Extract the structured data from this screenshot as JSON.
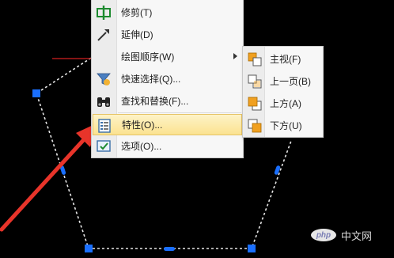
{
  "context_menu": {
    "items": [
      {
        "label": "修剪(T)",
        "icon": "trim-icon"
      },
      {
        "label": "延伸(D)",
        "icon": "extend-icon"
      },
      {
        "label": "绘图顺序(W)",
        "icon": "none",
        "has_submenu": true
      },
      {
        "label": "快速选择(Q)...",
        "icon": "quick-select-icon"
      },
      {
        "label": "查找和替换(F)...",
        "icon": "find-replace-icon"
      },
      {
        "label": "特性(O)...",
        "icon": "properties-icon",
        "highlighted": true
      },
      {
        "label": "选项(O)...",
        "icon": "options-icon"
      }
    ]
  },
  "submenu": {
    "items": [
      {
        "label": "主视(F)",
        "icon": "bring-to-front-icon"
      },
      {
        "label": "上一页(B)",
        "icon": "send-to-back-icon"
      },
      {
        "label": "上方(A)",
        "icon": "bring-above-icon"
      },
      {
        "label": "下方(U)",
        "icon": "send-under-icon"
      }
    ]
  },
  "watermark": {
    "logo": "php",
    "text": "中文网"
  },
  "colors": {
    "background": "#000000",
    "grip": "#1a6fff",
    "menu_highlight": "#fbe290",
    "annotation_arrow": "#e8342a"
  }
}
